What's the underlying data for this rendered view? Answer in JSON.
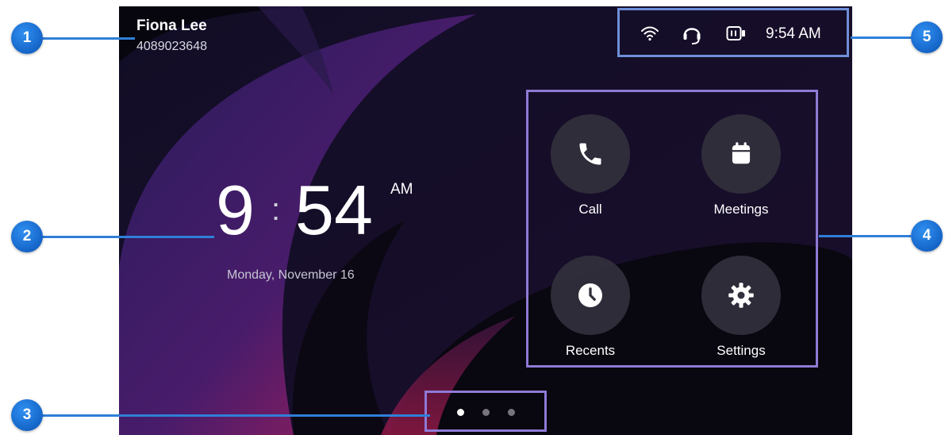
{
  "user": {
    "name": "Fiona Lee",
    "number": "4089023648"
  },
  "status_bar": {
    "icons": [
      "wifi-icon",
      "headset-icon",
      "device-icon"
    ],
    "time": "9:54 AM"
  },
  "clock": {
    "hour": "9",
    "separator": ":",
    "minutes": "54",
    "period": "AM",
    "date": "Monday, November 16"
  },
  "apps": [
    {
      "label": "Call",
      "icon": "phone-icon"
    },
    {
      "label": "Meetings",
      "icon": "calendar-icon"
    },
    {
      "label": "Recents",
      "icon": "clock-icon"
    },
    {
      "label": "Settings",
      "icon": "gear-icon"
    }
  ],
  "pager": {
    "pages": 3,
    "active": 1
  },
  "callouts": [
    "1",
    "2",
    "3",
    "4",
    "5"
  ],
  "colors": {
    "callout_blue": "#1565c8",
    "highlight_purple": "#8f7ad6",
    "status_highlight": "#6f8fd8",
    "app_button": "#32303c"
  }
}
